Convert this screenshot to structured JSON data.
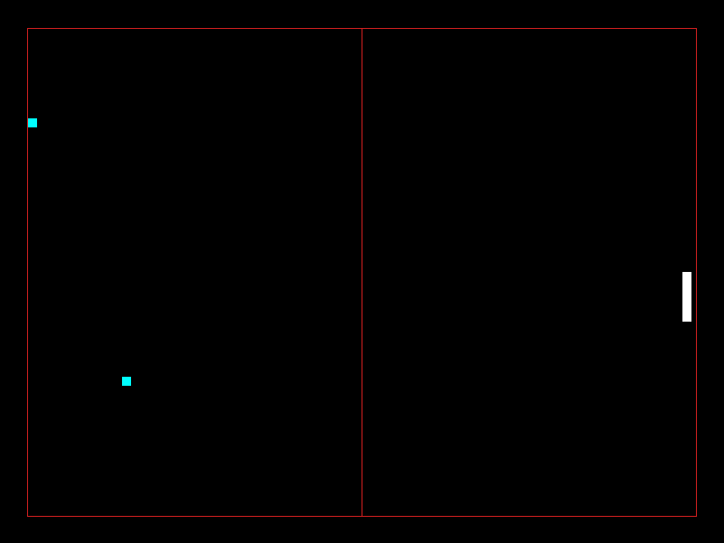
{
  "colors": {
    "background": "#000000",
    "court_border": "#d42020",
    "ball": "#00ffff",
    "paddle": "#ffffff"
  },
  "game": {
    "ball_count": 2,
    "paddle_count": 1
  }
}
